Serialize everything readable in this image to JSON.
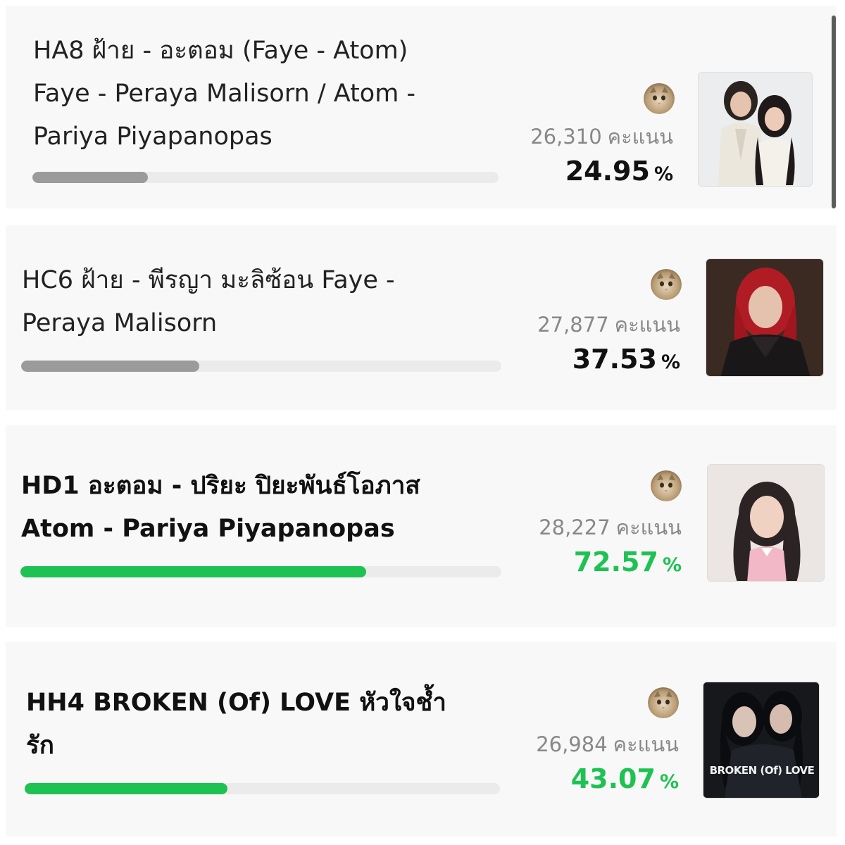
{
  "theme": {
    "green": "#1ec253",
    "gray": "#9b9b9b",
    "track": "#ebebeb"
  },
  "entries": [
    {
      "title_lines": [
        "HA8 ฝ้าย - อะตอม (Faye - Atom)",
        "Faye - Peraya Malisorn / Atom -",
        "Pariya Piyapanopas"
      ],
      "votes": "26,310",
      "votes_unit": "คะแนน",
      "percent": "24.95",
      "percent_sign": "%",
      "bar_fraction": 0.2495,
      "bar_color": "gray",
      "voter_avatar": "cat-avatar-icon",
      "thumbnail": "faye-atom-duo-photo"
    },
    {
      "title_lines": [
        "HC6 ฝ้าย - พีรญา มะลิซ้อน Faye -",
        "Peraya Malisorn"
      ],
      "votes": "27,877",
      "votes_unit": "คะแนน",
      "percent": "37.53",
      "percent_sign": "%",
      "bar_fraction": 0.3753,
      "bar_color": "gray",
      "voter_avatar": "cat-avatar-icon",
      "thumbnail": "faye-red-hair-photo"
    },
    {
      "title_lines": [
        "HD1 อะตอม - ปริยะ ปิยะพันธ์โอภาส",
        "Atom - Pariya Piyapanopas"
      ],
      "votes": "28,227",
      "votes_unit": "คะแนน",
      "percent": "72.57",
      "percent_sign": "%",
      "bar_fraction": 0.7257,
      "bar_color": "green",
      "voter_avatar": "cat-avatar-icon",
      "thumbnail": "atom-portrait-photo"
    },
    {
      "title_lines": [
        "HH4 BROKEN (Of) LOVE หัวใจช้ำ",
        "รัก"
      ],
      "votes": "26,984",
      "votes_unit": "คะแนน",
      "percent": "43.07",
      "percent_sign": "%",
      "bar_fraction": 0.4307,
      "bar_color": "green",
      "voter_avatar": "cat-avatar-icon",
      "thumbnail": "broken-of-love-poster",
      "poster_text": "BROKEN (Of) LOVE"
    }
  ]
}
